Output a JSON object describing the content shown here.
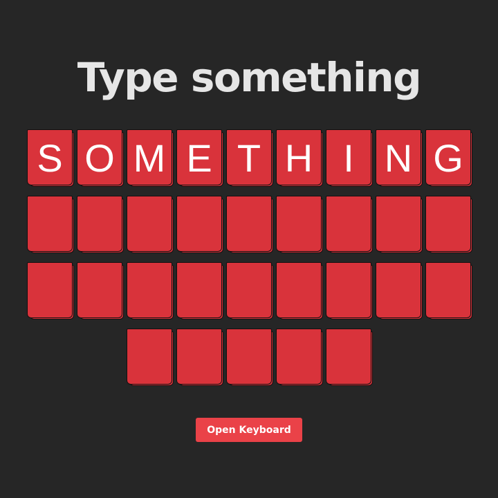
{
  "title": "Type something",
  "tiles": {
    "rows": [
      [
        "S",
        "O",
        "M",
        "E",
        "T",
        "H",
        "I",
        "N",
        "G"
      ],
      [
        "",
        "",
        "",
        "",
        "",
        "",
        "",
        "",
        ""
      ],
      [
        "",
        "",
        "",
        "",
        "",
        "",
        "",
        "",
        ""
      ],
      [
        "",
        "",
        "",
        "",
        ""
      ]
    ]
  },
  "open_keyboard_label": "Open Keyboard",
  "colors": {
    "background": "#262626",
    "tile": "#d9333b",
    "button": "#ea4248",
    "title_text": "#e6e6e6"
  }
}
